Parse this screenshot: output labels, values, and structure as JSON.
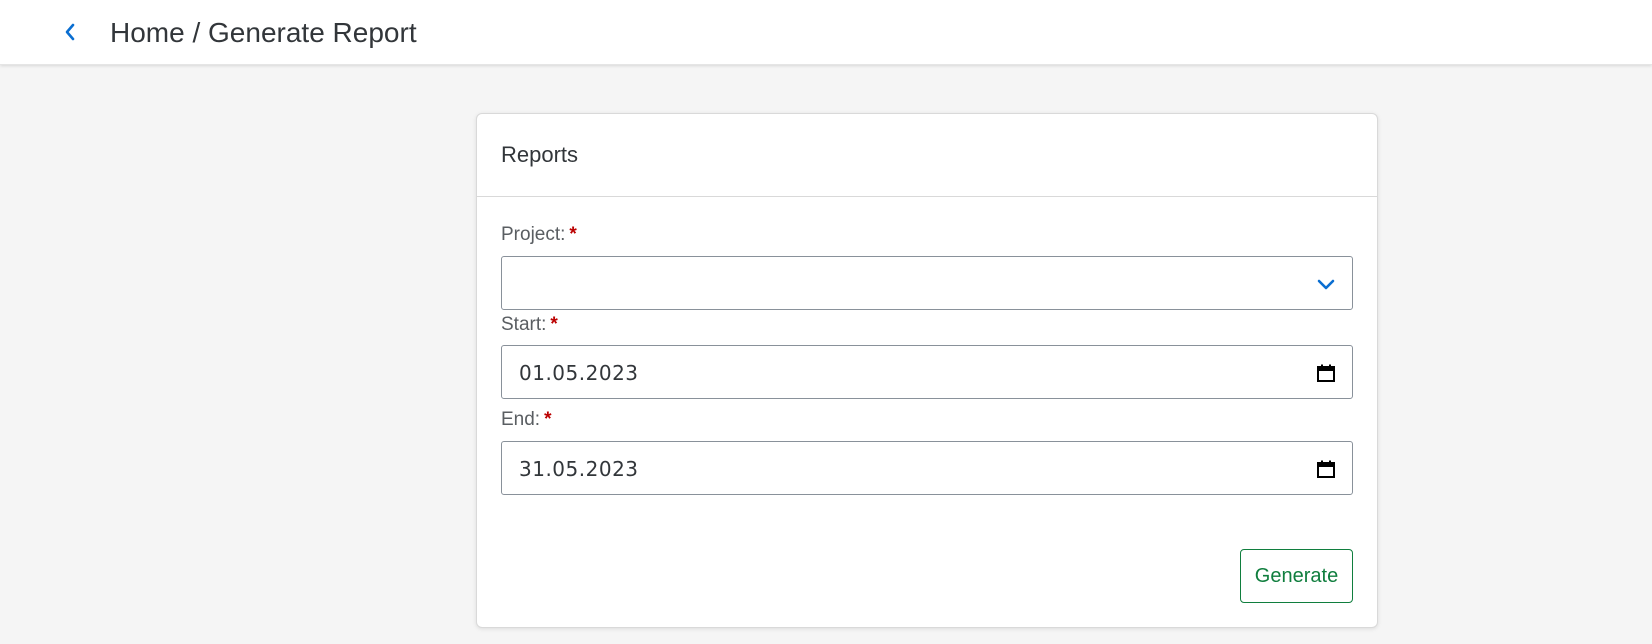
{
  "header": {
    "back_icon": "chevron-left-icon",
    "title": "Home / Generate Report"
  },
  "card": {
    "title": "Reports",
    "fields": {
      "project": {
        "label": "Project:",
        "required_marker": "*",
        "value": "",
        "icon": "chevron-down-icon"
      },
      "start": {
        "label": "Start:",
        "required_marker": "*",
        "value": "01.05.2023",
        "icon": "calendar-icon"
      },
      "end": {
        "label": "End:",
        "required_marker": "*",
        "value": "31.05.2023",
        "icon": "calendar-icon"
      }
    },
    "generate_label": "Generate"
  },
  "colors": {
    "accent": "#0a6ed1",
    "required": "#bb0000",
    "positive": "#107e3e",
    "background": "#f5f5f5"
  }
}
